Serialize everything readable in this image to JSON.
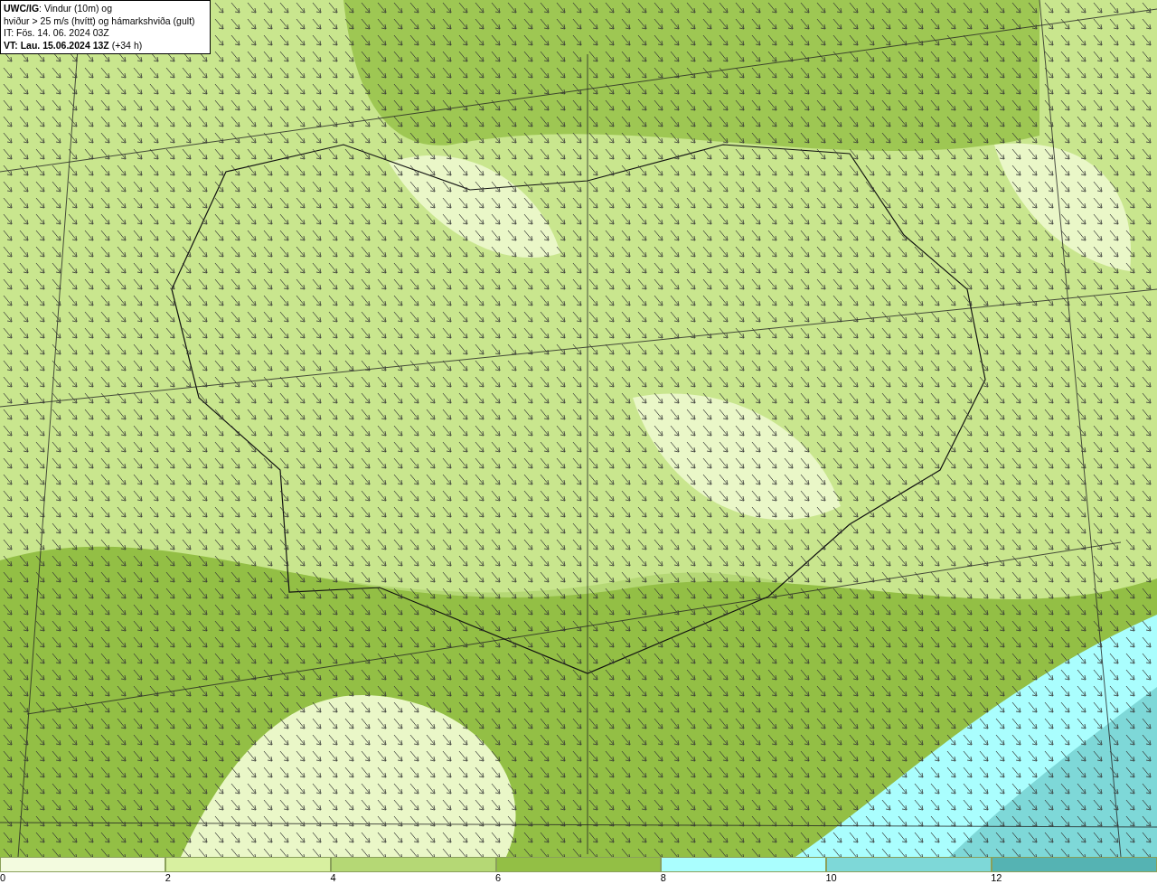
{
  "info_box": {
    "lines": [
      "**UWC/IG**: Vindur (10m) og",
      "hviður > 25 m/s (hvítt) og hámarkshviða (gult)",
      "IT: Fös. 14. 06. 2024 03Z",
      "**VT: Lau. 15.06.2024 13Z** (+34 h)"
    ]
  },
  "colorbar": {
    "bins": [
      {
        "color": "#f3fbdf"
      },
      {
        "color": "#d8f0a0"
      },
      {
        "color": "#b5d875"
      },
      {
        "color": "#93bf45"
      },
      {
        "color": "#aafefe"
      },
      {
        "color": "#7ed8d8"
      },
      {
        "color": "#55b3b3"
      }
    ],
    "ticks": [
      "0",
      "2",
      "4",
      "6",
      "8",
      "10",
      "12"
    ]
  }
}
